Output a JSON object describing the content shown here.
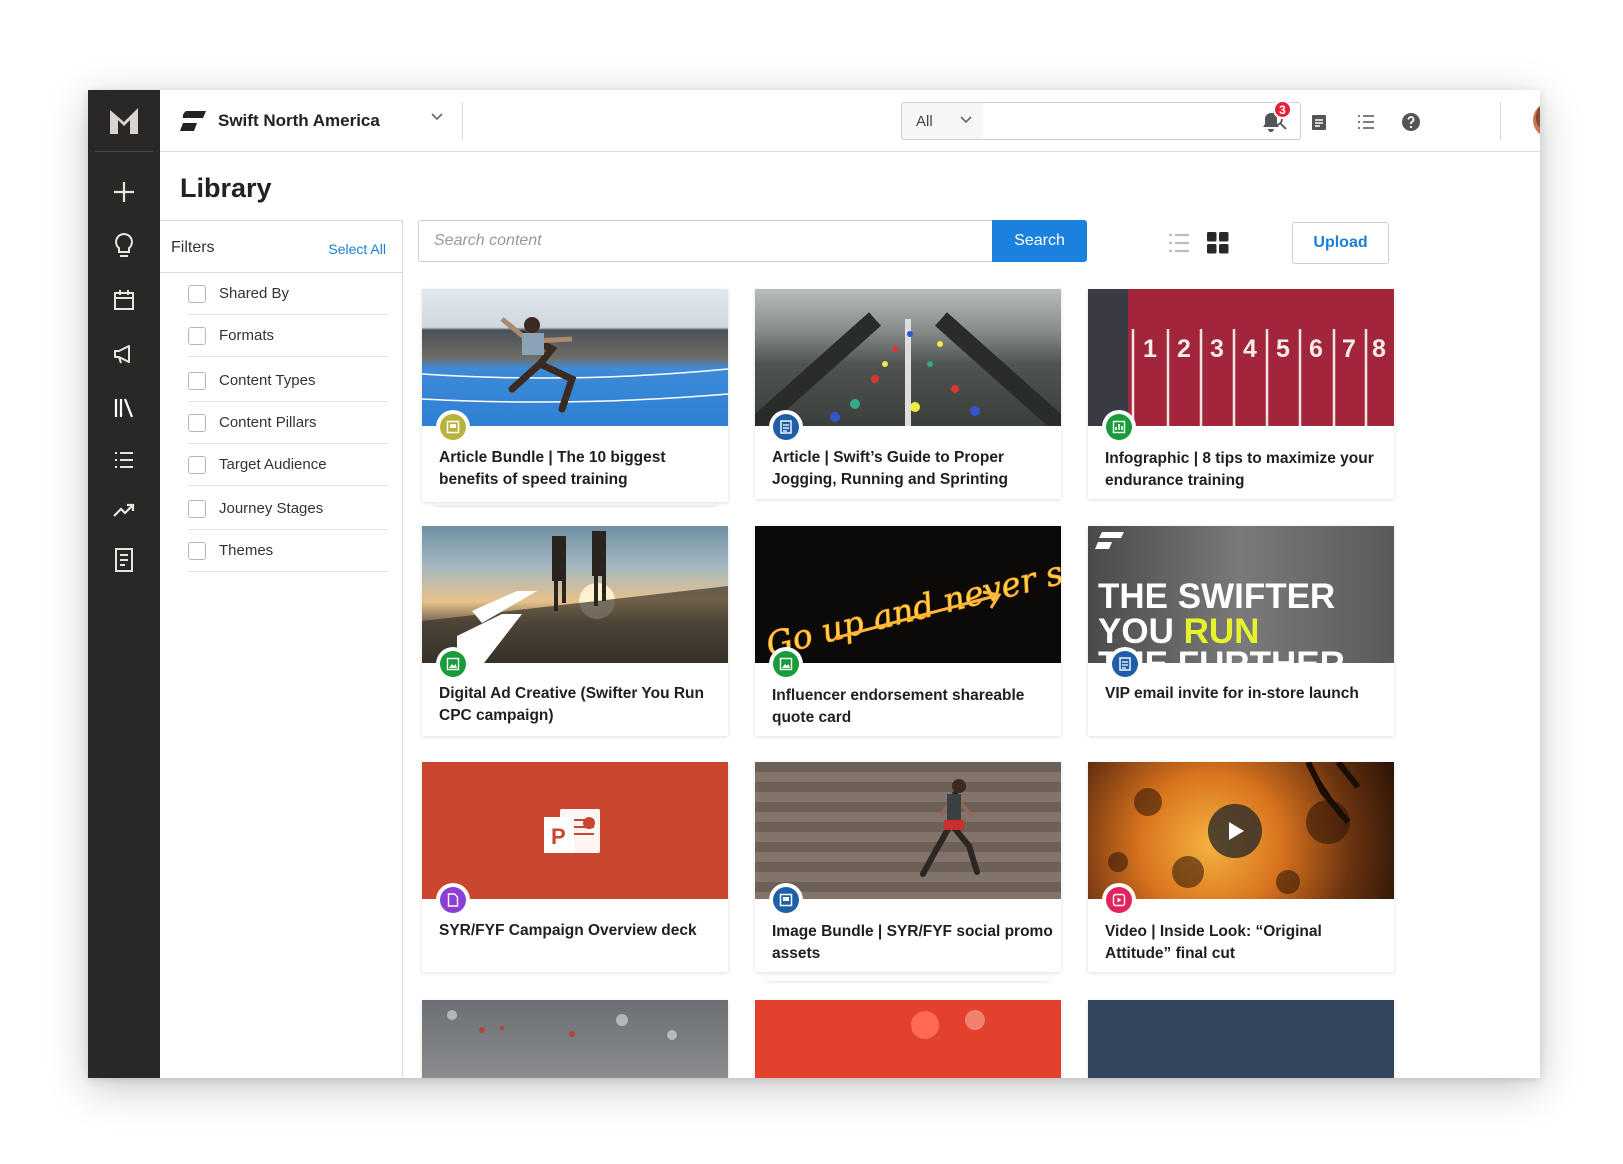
{
  "topbar": {
    "org_name": "Swift North America",
    "scope_value": "All",
    "search_placeholder": "",
    "notification_count": "3"
  },
  "page": {
    "title": "Library"
  },
  "filters": {
    "title": "Filters",
    "select_all": "Select All",
    "items": [
      "Shared By",
      "Formats",
      "Content Types",
      "Content Pillars",
      "Target Audience",
      "Journey Stages",
      "Themes"
    ]
  },
  "content_search": {
    "placeholder": "Search content",
    "button": "Search"
  },
  "upload_label": "Upload",
  "colors": {
    "accent": "#1a82de",
    "sidebar": "#2a2826",
    "badge": "#e2223b"
  },
  "cards": [
    {
      "title": "Article Bundle | The 10 biggest benefits of speed training",
      "icon": "bundle-icon",
      "color": "#b8b43a"
    },
    {
      "title": "Article | Swift’s Guide to Proper Jogging, Running and Sprinting",
      "icon": "article-icon",
      "color": "#1f5fa8"
    },
    {
      "title": "Infographic | 8 tips to maximize your endurance training",
      "icon": "infographic-icon",
      "color": "#1a9b3a"
    },
    {
      "title": "Digital Ad Creative (Swifter You Run CPC campaign)",
      "icon": "image-icon",
      "color": "#1a9b3a"
    },
    {
      "title": "Influencer endorsement shareable quote card",
      "icon": "image-icon",
      "color": "#1a9b3a"
    },
    {
      "title": "VIP email invite for in-store launch",
      "icon": "article-icon",
      "color": "#1f5fa8"
    },
    {
      "title": "SYR/FYF Campaign Overview deck",
      "icon": "document-icon",
      "color": "#8b3fd6"
    },
    {
      "title": "Image Bundle | SYR/FYF social promo assets",
      "icon": "bundle-icon",
      "color": "#1f5fa8"
    },
    {
      "title": "Video | Inside Look: “Original Attitude” final cut",
      "icon": "video-icon",
      "color": "#e0245e"
    }
  ],
  "card_images": {
    "neon_text": "Go up and never stop",
    "swifter_line1": "THE SWIFTER",
    "swifter_line2_a": "YOU ",
    "swifter_line2_b": "RUN",
    "swifter_line3": "THE FURTHER",
    "lane_numbers": [
      "1",
      "2",
      "3",
      "4",
      "5",
      "6",
      "7",
      "8"
    ],
    "ppt_letter": "P"
  }
}
